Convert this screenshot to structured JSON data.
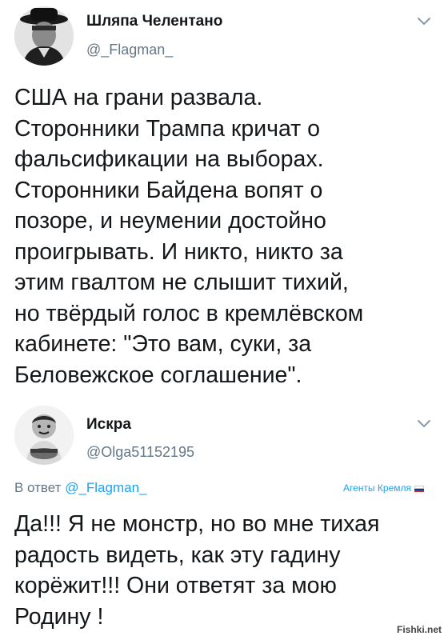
{
  "tweets": [
    {
      "author": {
        "name": "Шляпа Челентано",
        "handle": "@_Flagman_"
      },
      "text": "США на грани развала.\nСторонники Трампа кричат о\nфальсификации на выборах.\nСторонники Байдена вопят о\nпозоре, и неумении достойно\nпроигрывать. И никто, никто за\nэтим гвалтом не слышит тихий,\nно твёрдый голос в кремлёвском\nкабинете: \"Это вам, суки, за\nБеловежское соглашение\"."
    },
    {
      "author": {
        "name": "Искра",
        "handle": "@Olga51152195"
      },
      "reply_prefix": "В ответ",
      "reply_handle": "@_Flagman_",
      "tag": "Агенты Кремля",
      "text": "Да!!! Я не монстр, но во мне тихая\nрадость видеть, как эту гадину\nкорёжит!!! Они ответят за мою\nРодину !"
    }
  ],
  "icons": {
    "menu": "chevron-down-icon",
    "flag": "russian-flag-icon",
    "avatar1": "man-in-hat-avatar",
    "avatar2": "child-avatar"
  },
  "colors": {
    "text": "#14171a",
    "secondary": "#657786",
    "link": "#1da1f2"
  },
  "watermark": "Fishki.net"
}
